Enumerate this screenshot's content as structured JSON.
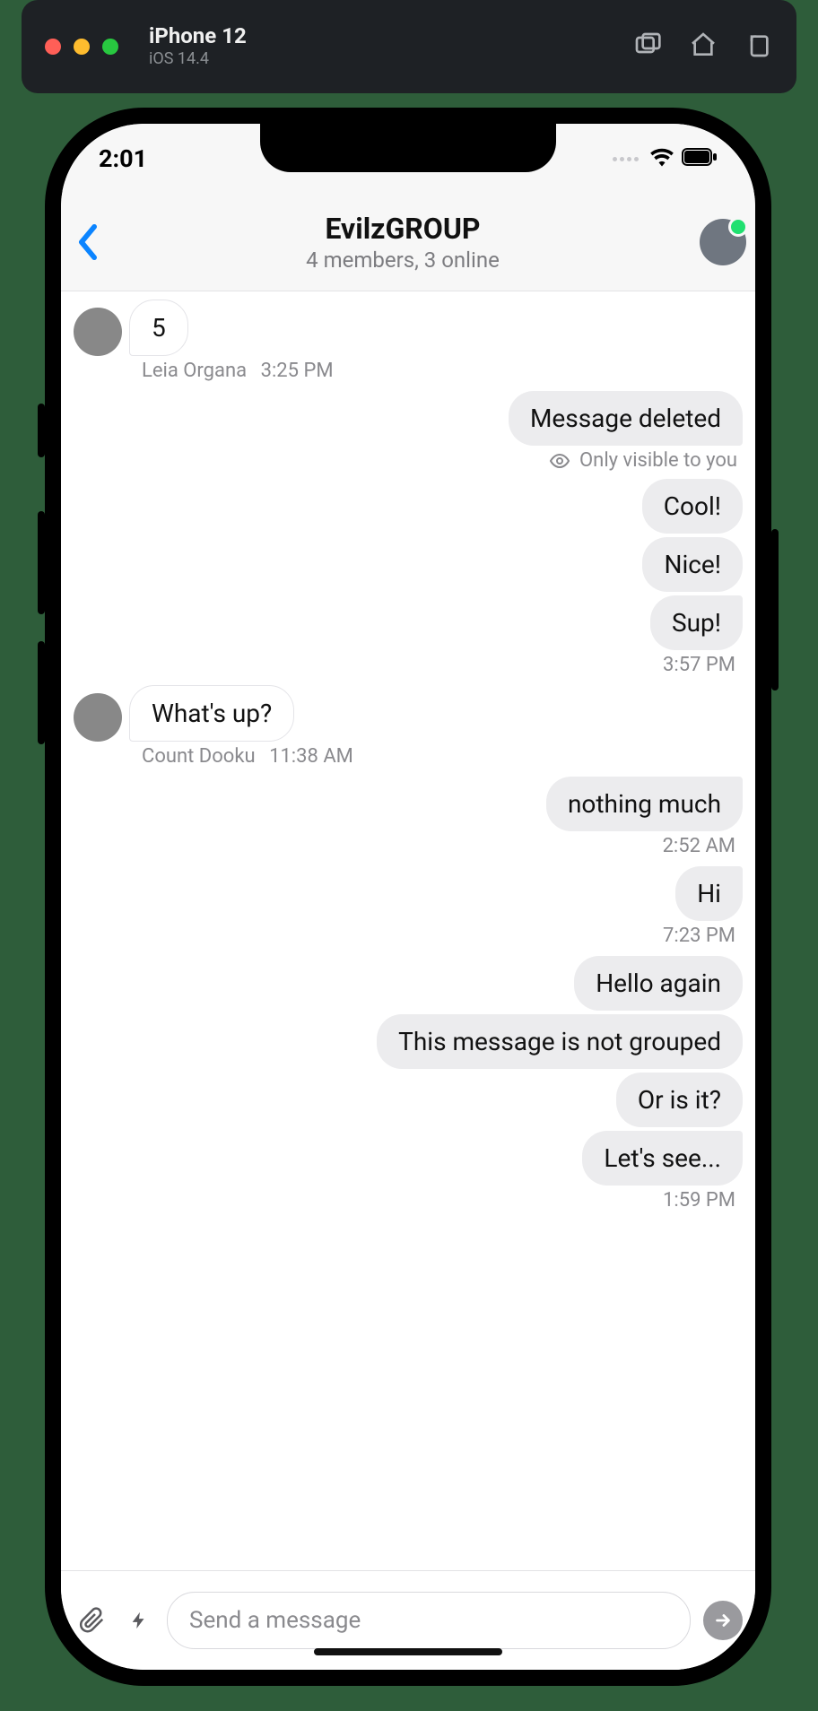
{
  "simulator": {
    "device": "iPhone 12",
    "os": "iOS 14.4"
  },
  "status": {
    "time": "2:01"
  },
  "header": {
    "title": "EvilzGROUP",
    "subtitle": "4 members, 3 online"
  },
  "composer": {
    "placeholder": "Send a message"
  },
  "sys": {
    "visible_only": "Only visible to you"
  },
  "m": {
    "leia_5": "5",
    "leia_name": "Leia Organa",
    "leia_time": "3:25 PM",
    "deleted": "Message deleted",
    "cool": "Cool!",
    "nice": "Nice!",
    "sup": "Sup!",
    "out_time1": "3:57 PM",
    "dooku_q": "What's up?",
    "dooku_name": "Count Dooku",
    "dooku_time": "11:38 AM",
    "nm": "nothing much",
    "nm_time": "2:52 AM",
    "hi": "Hi",
    "hi_time": "7:23 PM",
    "hello": "Hello again",
    "notgrp": "This message is not grouped",
    "orisit": "Or is it?",
    "letssee": "Let's see...",
    "out_time2": "1:59 PM"
  }
}
